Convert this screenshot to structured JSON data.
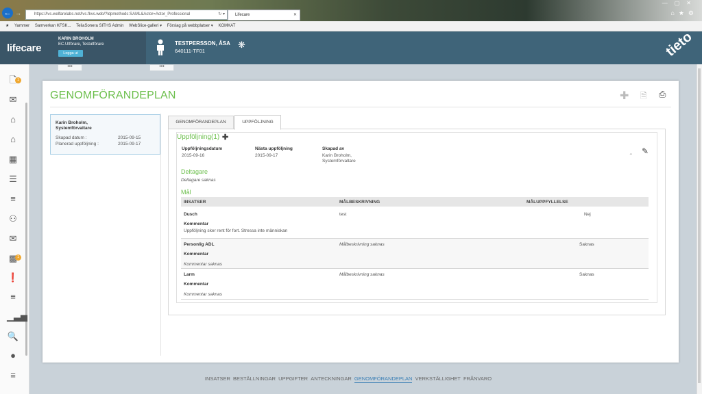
{
  "browser": {
    "url": "https://lvs.welfarelabs.net/lvs.fkvs.web/?ldpmethods:SAML&Actor=Actor_Professional",
    "tab_title": "Lifecare",
    "favorites": [
      "Yammer",
      "Samverkan KFSK...",
      "TeliaSonera SITHS Admin",
      "WebSlice-galleri ▾",
      "Förslag på webbplatser ▾",
      "KOMKAT"
    ]
  },
  "header": {
    "logo": "lifecare",
    "user_name": "KARIN BROHOLM",
    "user_role": "EC.Utförare, Testutförare",
    "logout_label": "Logga ut",
    "patient_name": "TESTPERSSON, ÅSA",
    "patient_id": "640111-TF01",
    "brand": "tieto",
    "more_label": "•••"
  },
  "page": {
    "title": "GENOMFÖRANDEPLAN"
  },
  "plan_card": {
    "name": "Karin Broholm, Systemförvaltare",
    "created_label": "Skapad datum :",
    "created_value": "2015-09-15",
    "planned_label": "Planerad uppföljning :",
    "planned_value": "2015-09-17"
  },
  "tabs": [
    {
      "label": "GENOMFÖRANDEPLAN"
    },
    {
      "label": "UPPFÖLJNING"
    }
  ],
  "followup": {
    "heading": "Uppföljning(1)",
    "date_label": "Uppföljningsdatum",
    "date_value": "2015-09-16",
    "next_label": "Nästa uppföljning",
    "next_value": "2015-09-17",
    "created_by_label": "Skapad av",
    "created_by_value": "Karin  Broholm, Systemförvaltare",
    "participants_heading": "Deltagare",
    "participants_empty": "Deltagare saknas",
    "goals_heading": "Mål",
    "columns": [
      "INSATSER",
      "MÅLBESKRIVNING",
      "MÅLUPPFYLLELSE"
    ],
    "comment_label": "Kommentar",
    "rows": [
      {
        "insats": "Dusch",
        "description": "test",
        "fulfillment": "Nej",
        "comment": "Uppföljning sker rent för fort. Stressa inte människan"
      },
      {
        "insats": "Personlig ADL",
        "description": "Målbeskrivning saknas",
        "fulfillment": "Saknas",
        "comment": "Kommentar saknas"
      },
      {
        "insats": "Larm",
        "description": "Målbeskrivning saknas",
        "fulfillment": "Saknas",
        "comment": "Kommentar saknas"
      }
    ]
  },
  "footer_nav": [
    "INSATSER",
    "BESTÄLLNINGAR",
    "UPPGIFTER",
    "ANTECKNINGAR",
    "GENOMFÖRANDEPLAN",
    "VERKSTÄLLIGHET",
    "FRÅNVARO"
  ],
  "footer_active": "GENOMFÖRANDEPLAN",
  "badges": {
    "top": "1",
    "mid": "1"
  },
  "colors": {
    "accent_green": "#6cbf4c",
    "header_blue": "#3f6479",
    "link_blue": "#3b7fb5",
    "badge_orange": "#f0a830"
  }
}
